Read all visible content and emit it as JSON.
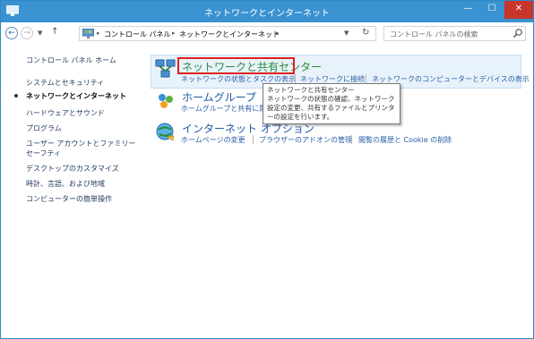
{
  "window": {
    "title": "ネットワークとインターネット"
  },
  "nav": {
    "breadcrumb": [
      "コントロール パネル",
      "ネットワークとインターネット"
    ],
    "search_placeholder": "コントロール パネルの検索"
  },
  "sidebar": {
    "items": [
      {
        "label": "コントロール パネル ホーム"
      },
      {
        "label": "システムとセキュリティ"
      },
      {
        "label": "ネットワークとインターネット",
        "current": true
      },
      {
        "label": "ハードウェアとサウンド"
      },
      {
        "label": "プログラム"
      },
      {
        "label": "ユーザー アカウントとファミリー セーフティ"
      },
      {
        "label": "デスクトップのカスタマイズ"
      },
      {
        "label": "時計、言語、および地域"
      },
      {
        "label": "コンピューターの簡単操作"
      }
    ]
  },
  "categories": [
    {
      "title": "ネットワークと共有センター",
      "links": [
        "ネットワークの状態とタスクの表示",
        "ネットワークに接続",
        "ネットワークのコンピューターとデバイスの表示"
      ]
    },
    {
      "title": "ホームグループ",
      "links": [
        "ホームグループと共有に関"
      ]
    },
    {
      "title": "インターネット オプション",
      "links": [
        "ホームページの変更",
        "ブラウザーのアドオンの管理",
        "閲覧の履歴と Cookie の削除"
      ]
    }
  ],
  "tooltip": {
    "title": "ネットワークと共有センター",
    "body": "ネットワークの状態の確認、ネットワーク設定の変更、共有するファイルとプリンターの設定を行います。"
  },
  "colors": {
    "titlebar": "#3a92d0",
    "link": "#1e5aa6",
    "close": "#c7352b",
    "highlight": "#e8f2fb",
    "annotation": "#e02020"
  },
  "icons": {
    "app": "control-panel-icon",
    "back": "back-arrow-icon",
    "forward": "forward-arrow-icon",
    "up": "up-arrow-icon",
    "refresh": "refresh-icon",
    "search": "search-icon",
    "network": "network-sharing-center-icon",
    "homegroup": "homegroup-icon",
    "internet": "internet-options-icon"
  }
}
